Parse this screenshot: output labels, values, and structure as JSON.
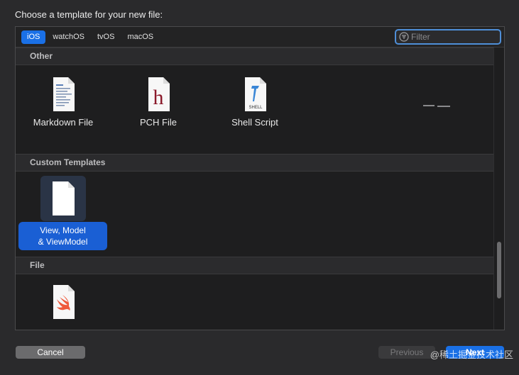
{
  "window": {
    "title": "Choose a template for your new file:"
  },
  "platform_tabs": [
    {
      "label": "iOS",
      "active": true
    },
    {
      "label": "watchOS",
      "active": false
    },
    {
      "label": "tvOS",
      "active": false
    },
    {
      "label": "macOS",
      "active": false
    }
  ],
  "filter": {
    "placeholder": "Filter",
    "icon": "filter-icon"
  },
  "sections": {
    "other": {
      "title": "Other",
      "items": [
        {
          "label": "Markdown File",
          "icon": "markdown-file-icon"
        },
        {
          "label": "PCH File",
          "icon": "pch-file-icon",
          "glyph": "h"
        },
        {
          "label": "Shell Script",
          "icon": "shell-script-icon",
          "glyph": "SHELL"
        }
      ]
    },
    "custom": {
      "title": "Custom Templates",
      "items": [
        {
          "label": "View, Model\n& ViewModel",
          "icon": "blank-document-icon",
          "selected": true
        }
      ]
    },
    "file": {
      "title": "File",
      "items": [
        {
          "label": "",
          "icon": "swift-file-icon"
        }
      ]
    }
  },
  "buttons": {
    "cancel": "Cancel",
    "previous": "Previous",
    "next": "Next"
  },
  "watermark": "@稀土掘金技术社区",
  "colors": {
    "accent": "#1a70e6",
    "selected": "#1a5fd4",
    "background": "#1e1e1f"
  }
}
